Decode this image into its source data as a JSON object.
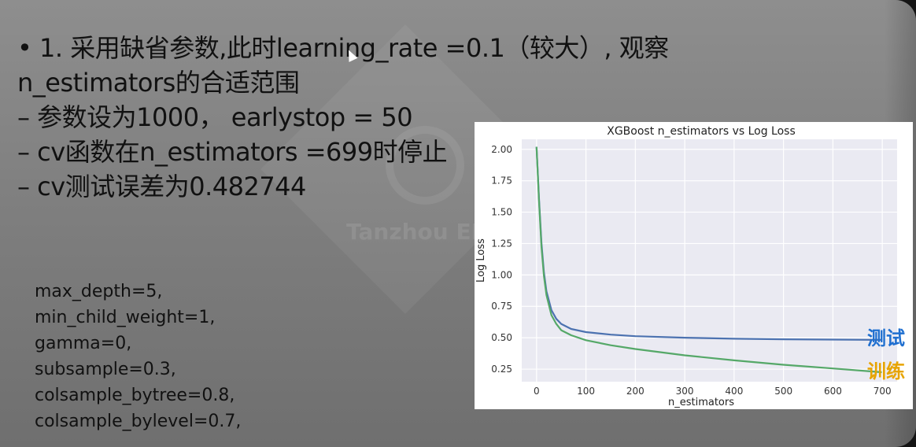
{
  "bullets": {
    "line1": "• 1. 采用缺省参数,此时learning_rate =0.1（较大）,   观察",
    "line2": "n_estimators的合适范围",
    "line3": "– 参数设为1000， earlystop = 50",
    "line4": "– cv函数在n_estimators =699时停止",
    "line5": "– cv测试误差为0.482744"
  },
  "params": [
    "max_depth=5,",
    "min_child_weight=1,",
    "gamma=0,",
    "subsample=0.3,",
    "colsample_bytree=0.8,",
    "colsample_bylevel=0.7,"
  ],
  "annotations": {
    "test_label": "测试",
    "train_label": "训练"
  },
  "watermark": {
    "text": "Tanzhou EDU"
  },
  "colors": {
    "test": "#4c72b0",
    "train": "#55a868",
    "plot_bg": "#eaeaf2",
    "test_annotation": "#1f6fd0",
    "train_annotation": "#e7a400"
  },
  "chart_data": {
    "type": "line",
    "title": "XGBoost n_estimators vs Log Loss",
    "xlabel": "n_estimators",
    "ylabel": "Log Loss",
    "xlim": [
      -30,
      730
    ],
    "ylim": [
      0.15,
      2.08
    ],
    "xticks": [
      0,
      100,
      200,
      300,
      400,
      500,
      600,
      700
    ],
    "yticks": [
      0.25,
      0.5,
      0.75,
      1.0,
      1.25,
      1.5,
      1.75,
      2.0
    ],
    "ytick_labels": [
      "0.25",
      "0.50",
      "0.75",
      "1.00",
      "1.25",
      "1.50",
      "1.75",
      "2.00"
    ],
    "grid": true,
    "x": [
      0,
      5,
      10,
      15,
      20,
      30,
      40,
      50,
      70,
      100,
      150,
      200,
      300,
      400,
      500,
      600,
      699
    ],
    "series": [
      {
        "color": "#4c72b0",
        "values": [
          2.02,
          1.6,
          1.25,
          1.02,
          0.87,
          0.72,
          0.65,
          0.61,
          0.57,
          0.545,
          0.525,
          0.512,
          0.5,
          0.492,
          0.488,
          0.485,
          0.483
        ]
      },
      {
        "color": "#55a868",
        "values": [
          2.02,
          1.58,
          1.22,
          0.99,
          0.84,
          0.68,
          0.61,
          0.56,
          0.52,
          0.48,
          0.44,
          0.41,
          0.36,
          0.32,
          0.285,
          0.255,
          0.225
        ]
      }
    ]
  }
}
